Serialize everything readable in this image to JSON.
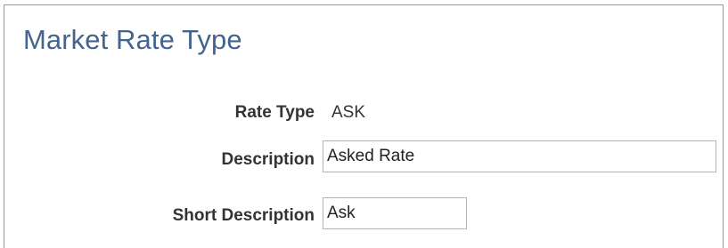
{
  "page": {
    "title": "Market Rate Type"
  },
  "form": {
    "rate_type": {
      "label": "Rate Type",
      "value": "ASK"
    },
    "description": {
      "label": "Description",
      "value": "Asked Rate"
    },
    "short_description": {
      "label": "Short Description",
      "value": "Ask"
    }
  },
  "colors": {
    "title": "#44638f",
    "label": "#333333",
    "field_border": "#b4b4b4"
  }
}
